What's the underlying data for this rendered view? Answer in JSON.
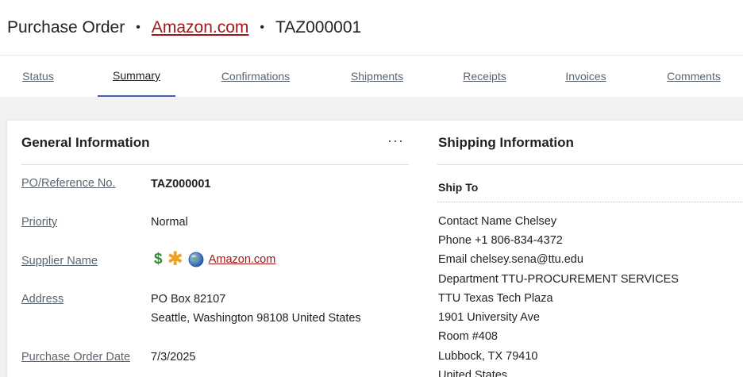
{
  "header": {
    "title": "Purchase Order",
    "separator": "•",
    "supplier_link": "Amazon.com",
    "po_number": "TAZ000001"
  },
  "tabs": [
    {
      "label": "Status"
    },
    {
      "label": "Summary"
    },
    {
      "label": "Confirmations"
    },
    {
      "label": "Shipments"
    },
    {
      "label": "Receipts"
    },
    {
      "label": "Invoices"
    },
    {
      "label": "Comments"
    }
  ],
  "general": {
    "title": "General Information",
    "more_menu": "···",
    "po_ref_label": "PO/Reference No.",
    "po_ref_value": "TAZ000001",
    "priority_label": "Priority",
    "priority_value": "Normal",
    "supplier_label": "Supplier Name",
    "supplier_value": "Amazon.com",
    "supplier_icons": [
      "dollar-icon",
      "asterisk-icon",
      "globe-icon"
    ],
    "address_label": "Address",
    "address_line1": "PO Box 82107",
    "address_line2": "Seattle, Washington 98108 United States",
    "po_date_label": "Purchase Order Date",
    "po_date_value": "7/3/2025"
  },
  "shipping": {
    "title": "Shipping Information",
    "ship_to_label": "Ship To",
    "lines": [
      "Contact Name Chelsey",
      "Phone +1 806-834-4372",
      "Email chelsey.sena@ttu.edu",
      "Department TTU-PROCUREMENT SERVICES",
      "TTU Texas Tech Plaza",
      "1901 University Ave",
      "Room #408",
      "Lubbock, TX 79410",
      "United States"
    ]
  },
  "colors": {
    "link_red": "#a01818",
    "tab_active_underline": "#3a64a8",
    "label_gray": "#5a6470"
  }
}
